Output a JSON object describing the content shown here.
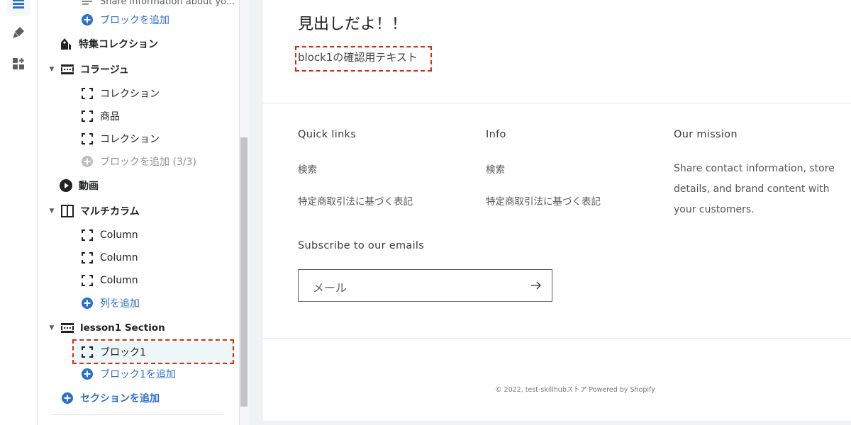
{
  "sidebar": {
    "top_partial_label": "Share information about yo...",
    "top_add_block": "ブロックを追加",
    "featured_collection": "特集コレクション",
    "collage": {
      "title": "コラージュ",
      "blocks": [
        "コレクション",
        "商品",
        "コレクション"
      ],
      "add_block": "ブロックを追加 (3/3)"
    },
    "video": "動画",
    "multicolumn": {
      "title": "マルチカラム",
      "blocks": [
        "Column",
        "Column",
        "Column"
      ],
      "add_column": "列を追加"
    },
    "lesson_section": {
      "title": "lesson1 Section",
      "block": "ブロック1",
      "add_block": "ブロック1を追加"
    },
    "add_section": "セクションを追加"
  },
  "preview": {
    "heading": "見出しだよ！！",
    "block_text": "block1の確認用テキスト",
    "footer": {
      "quick_links": {
        "title": "Quick links",
        "links": [
          "検索",
          "特定商取引法に基づく表記"
        ]
      },
      "info": {
        "title": "Info",
        "links": [
          "検索",
          "特定商取引法に基づく表記"
        ]
      },
      "mission": {
        "title": "Our mission",
        "text": "Share contact information, store details, and brand content with your customers."
      },
      "subscribe_title": "Subscribe to our emails",
      "email_placeholder": "メール",
      "copyright": "© 2022, test-skillhubストア Powered by Shopify"
    }
  },
  "icons": [
    "sections-icon",
    "theme-settings-icon",
    "apps-icon",
    "add-circle-icon",
    "tag-icon",
    "collage-icon",
    "block-icon",
    "play-icon",
    "columns-icon",
    "arrow-right-icon"
  ],
  "colors": {
    "accent": "#2c6ecb",
    "highlight": "#d72c0d",
    "selected_bg": "#eef7f8"
  }
}
